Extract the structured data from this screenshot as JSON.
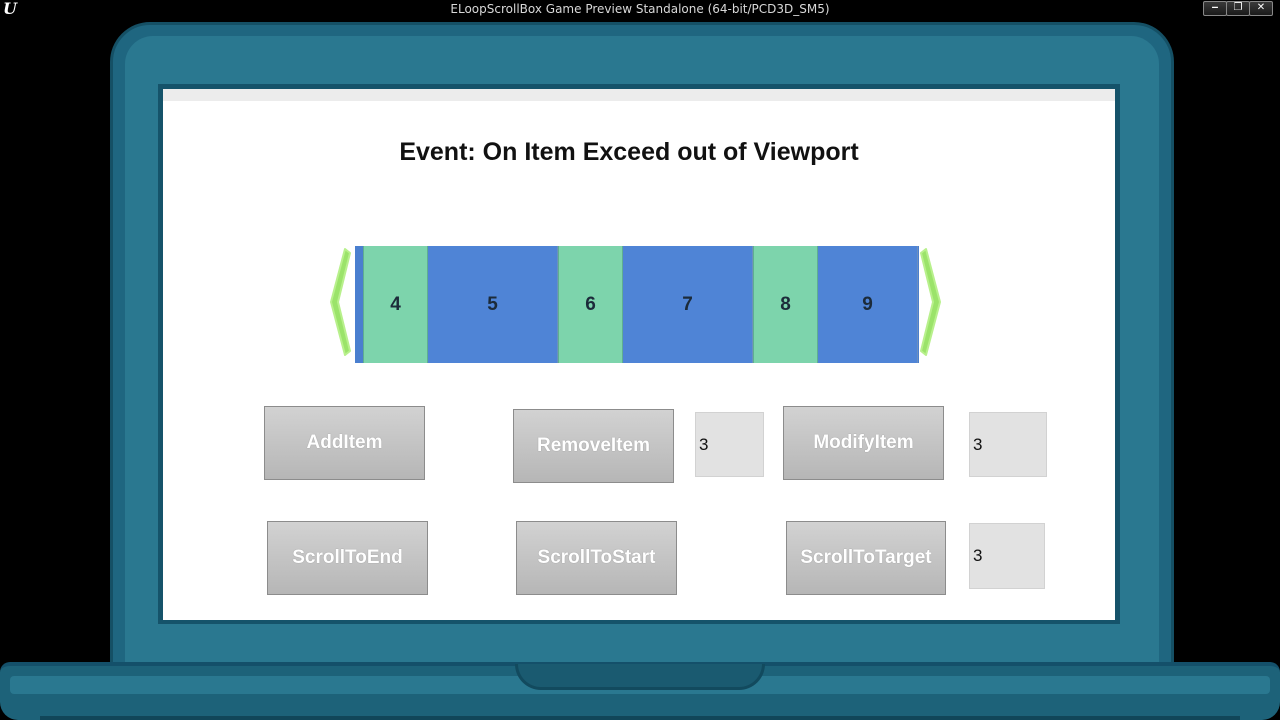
{
  "window": {
    "title": "ELoopScrollBox Game Preview Standalone (64-bit/PCD3D_SM5)",
    "logo": "U",
    "minimize_label": "‒",
    "restore_label": "❐",
    "close_label": "✕"
  },
  "screen": {
    "title": "Event: On Item Exceed out of Viewport"
  },
  "scroll_items": [
    {
      "label": "4",
      "color": "#7dd4ac"
    },
    {
      "label": "5",
      "color": "#4f84d6"
    },
    {
      "label": "6",
      "color": "#7dd4ac"
    },
    {
      "label": "7",
      "color": "#4f84d6"
    },
    {
      "label": "8",
      "color": "#7dd4ac"
    },
    {
      "label": "9",
      "color": "#4f84d6"
    }
  ],
  "controls": {
    "add_item": "AddItem",
    "remove_item": "RemoveItem",
    "remove_index": "3",
    "modify_item": "ModifyItem",
    "modify_index": "3",
    "scroll_to_end": "ScrollToEnd",
    "scroll_to_start": "ScrollToStart",
    "scroll_to_target": "ScrollToTarget",
    "target_index": "3"
  },
  "colors": {
    "arrow": "#9be36a",
    "laptop": "#1f6680"
  },
  "icons": {
    "left_arrow": "chevron-left-icon",
    "right_arrow": "chevron-right-icon"
  }
}
